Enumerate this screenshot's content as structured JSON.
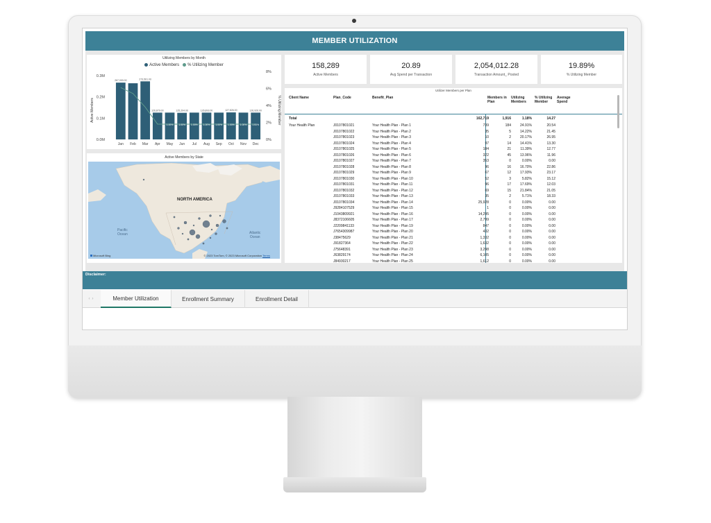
{
  "report": {
    "title": "MEMBER UTILIZATION",
    "disclaimer": "Disclaimer:"
  },
  "kpis": [
    {
      "value": "158,289",
      "label": "Active Members"
    },
    {
      "value": "20.89",
      "label": "Avg Spend per Transaction"
    },
    {
      "value": "2,054,012.28",
      "label": "Transaction Amount_ Posted"
    },
    {
      "value": "19.89%",
      "label": "% Utilizing Member"
    }
  ],
  "chart_data": {
    "type": "bar",
    "title": "Utilizing Members by Month",
    "categories": [
      "Jan",
      "Feb",
      "Mar",
      "Apr",
      "May",
      "Jun",
      "Jul",
      "Aug",
      "Sep",
      "Oct",
      "Nov",
      "Dec"
    ],
    "series": [
      {
        "name": "Active Members",
        "values": [
          267000,
          264000,
          273000,
          126000,
          126000,
          125000,
          126000,
          126000,
          126000,
          127000,
          126000,
          126000
        ],
        "labels": [
          "267,000.00",
          "",
          "273,561.00",
          "126,879.00",
          "",
          "125,204.00",
          "",
          "126,893.00",
          "",
          "127,826.00",
          "",
          "126,926.00"
        ]
      },
      {
        "name": "% Utilizing Member",
        "values": [
          6.1,
          5.4,
          3.8,
          1.8,
          1.8,
          1.8,
          1.8,
          1.8,
          1.8,
          1.8,
          1.8,
          1.8
        ],
        "labels": [
          "",
          "",
          "",
          "",
          "1.00%",
          "1.00%",
          "1.00%",
          "1.00%",
          "1.00%",
          "1.00%",
          "1.00%",
          "1.00%"
        ]
      }
    ],
    "ylabel": "Active Members",
    "y2label": "% Utilizing Member",
    "yticks": [
      "0.3M",
      "0.2M",
      "0.1M",
      "0.0M"
    ],
    "y2ticks": [
      "8%",
      "6%",
      "4%",
      "2%",
      "0%"
    ],
    "ylim": [
      0,
      300000
    ],
    "y2lim": [
      0,
      8
    ],
    "colors": {
      "bar": "#2e5f77",
      "line": "#5f9b8c"
    }
  },
  "map": {
    "title": "Active Members by State",
    "continent": "NORTH AMERICA",
    "pacific": "Pacific\nOcean",
    "atlantic": "Atlantic\nOcean",
    "brand": "Microsoft Bing",
    "copyright": "© 2023 TomTom, © 2023 Microsoft Corporation",
    "terms": "Terms"
  },
  "table": {
    "title": "Utilizer Members per Plan",
    "headers": {
      "client": "Client Name",
      "plan_code": "Plan_Code",
      "benefit": "Benefit_Plan",
      "members": "Members in Plan",
      "utilizing": "Utilizing Members",
      "pct": "% Utilizing Member",
      "avg": "Average Spend"
    },
    "total": {
      "label": "Total",
      "members": "162,719",
      "utilizing": "1,916",
      "pct": "1.18%",
      "avg": "14.27"
    },
    "client": "Your Health Plan",
    "rows": [
      [
        "J0107801021",
        "Your Health Plan - Plan 1",
        "739",
        "184",
        "24.91%",
        "20.54"
      ],
      [
        "J0107801022",
        "Your Health Plan - Plan 2",
        "35",
        "5",
        "14.22%",
        "21.45"
      ],
      [
        "J0107801023",
        "Your Health Plan - Plan 3",
        "10",
        "2",
        "20.17%",
        "26.95"
      ],
      [
        "J0107801024",
        "Your Health Plan - Plan 4",
        "97",
        "14",
        "14.41%",
        "13.30"
      ],
      [
        "J0107801025",
        "Your Health Plan - Plan 5",
        "184",
        "21",
        "11.39%",
        "12.77"
      ],
      [
        "J0107801026",
        "Your Health Plan - Plan 6",
        "322",
        "45",
        "13.96%",
        "11.96"
      ],
      [
        "J0107801027",
        "Your Health Plan - Plan 7",
        "353",
        "0",
        "0.00%",
        "0.00"
      ],
      [
        "J0107801028",
        "Your Health Plan - Plan 8",
        "96",
        "16",
        "16.70%",
        "22.86"
      ],
      [
        "J0107801029",
        "Your Health Plan - Plan 9",
        "67",
        "12",
        "17.93%",
        "23.17"
      ],
      [
        "J0107801030",
        "Your Health Plan - Plan 10",
        "52",
        "3",
        "5.82%",
        "15.12"
      ],
      [
        "J0107801031",
        "Your Health Plan - Plan 11",
        "96",
        "17",
        "17.69%",
        "12.03"
      ],
      [
        "J0107801032",
        "Your Health Plan - Plan 12",
        "69",
        "15",
        "21.84%",
        "21.05"
      ],
      [
        "J0107801033",
        "Your Health Plan - Plan 13",
        "35",
        "2",
        "5.71%",
        "18.33"
      ],
      [
        "J0107801034",
        "Your Health Plan - Plan 14",
        "25,928",
        "0",
        "0.00%",
        "0.00"
      ],
      [
        "J9284107529",
        "Your Health Plan - Plan 15",
        "1",
        "0",
        "0.00%",
        "0.00"
      ],
      [
        "J1043809921",
        "Your Health Plan - Plan 16",
        "14,295",
        "0",
        "0.00%",
        "0.00"
      ],
      [
        "J8372106605",
        "Your Health Plan - Plan 17",
        "2,799",
        "0",
        "0.00%",
        "0.00"
      ],
      [
        "J2209841133",
        "Your Health Plan - Plan 19",
        "847",
        "0",
        "0.00%",
        "0.00"
      ],
      [
        "J7654309987",
        "Your Health Plan - Plan 20",
        "432",
        "0",
        "0.00%",
        "0.00"
      ],
      [
        "J38475629",
        "Your Health Plan - Plan 21",
        "1,332",
        "0",
        "0.00%",
        "0.00"
      ],
      [
        "J91827364",
        "Your Health Plan - Plan 22",
        "1,632",
        "0",
        "0.00%",
        "0.00"
      ],
      [
        "J75648391",
        "Your Health Plan - Plan 23",
        "3,298",
        "0",
        "0.00%",
        "0.00"
      ],
      [
        "J63829174",
        "Your Health Plan - Plan 24",
        "6,105",
        "0",
        "0.00%",
        "0.00"
      ],
      [
        "J84930217",
        "Your Health Plan - Plan 25",
        "1,612",
        "0",
        "0.00%",
        "0.00"
      ]
    ]
  },
  "tabs": [
    {
      "label": "Member Utilization",
      "active": true
    },
    {
      "label": "Enrollment Summary",
      "active": false
    },
    {
      "label": "Enrollment Detail",
      "active": false
    }
  ],
  "nav": {
    "prev": "‹",
    "next": "›"
  }
}
